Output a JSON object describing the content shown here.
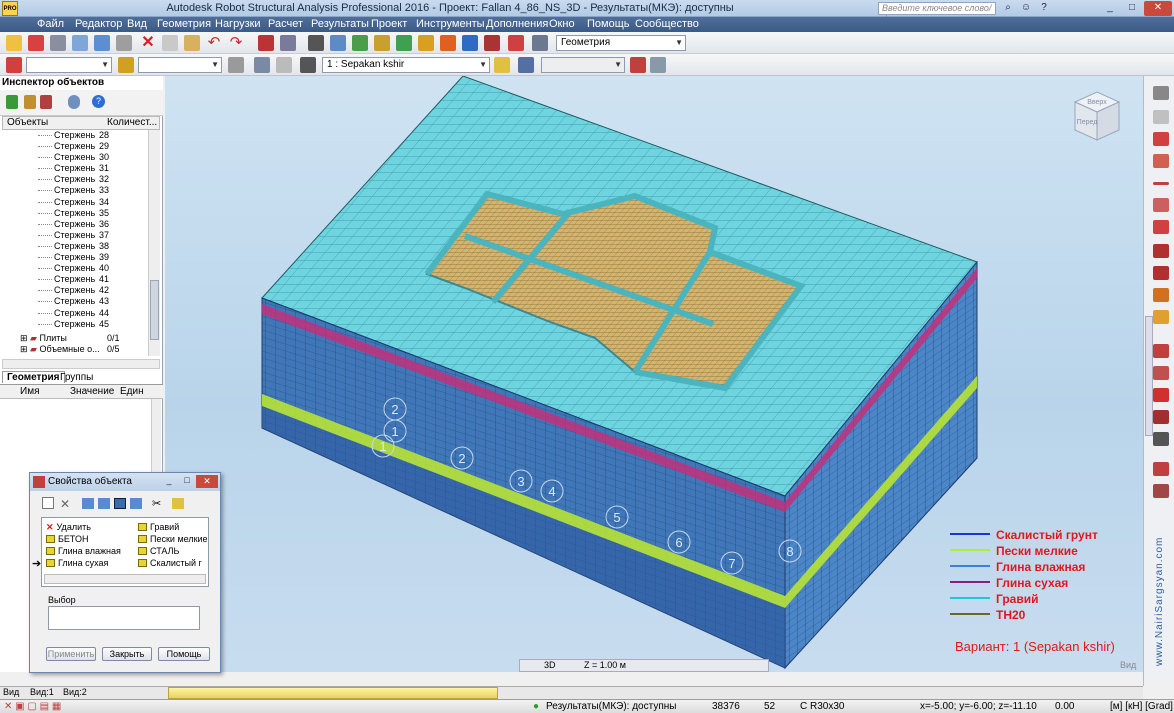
{
  "app": {
    "title": "Autodesk Robot Structural Analysis Professional 2016 - Проект: Fallan 4_86_NS_3D - Результаты(МКЭ): доступны",
    "search_placeholder": "Введите ключевое слово/фразу",
    "logo_label": "PRO"
  },
  "menu": [
    "Файл",
    "Редактор",
    "Вид",
    "Геометрия",
    "Нагрузки",
    "Расчет",
    "Результаты",
    "Проект",
    "Инструменты",
    "Дополнения",
    "Окно",
    "Помощь",
    "Сообщество"
  ],
  "toolbar1": {
    "geometry_combo": "Геометрия"
  },
  "toolbar2": {
    "load_case_combo": "1 : Sepakan kshir"
  },
  "inspector": {
    "title": "Инспектор объектов",
    "col_objects": "Объекты",
    "col_count": "Количест...",
    "bars_label": "Стержень",
    "bars": [
      28,
      29,
      30,
      31,
      32,
      33,
      34,
      35,
      36,
      37,
      38,
      39,
      40,
      41,
      42,
      43,
      44,
      45
    ],
    "plates_label": "Плиты",
    "plates_count": "0/1",
    "volumes_label": "Объемные о...",
    "volumes_count": "0/5",
    "tab_geometry": "Геометрия",
    "tab_groups": "Группы",
    "prop_col_name": "Имя",
    "prop_col_value": "Значение",
    "prop_col_unit": "Един"
  },
  "props_dialog": {
    "title": "Свойства объекта",
    "materials_left": [
      "Удалить",
      "БЕТОН",
      "Глина влажная",
      "Глина сухая"
    ],
    "materials_right": [
      "Гравий",
      "Пески мелкие",
      "СТАЛЬ",
      "Скалистый г"
    ],
    "selection_label": "Выбор",
    "apply_button": "Применить",
    "close_button": "Закрыть",
    "help_button": "Помощь"
  },
  "viewport": {
    "view_mode": "3D",
    "z_level": "Z = 1.00 м",
    "view_cube_top": "Вверх",
    "view_cube_front": "Перед",
    "corner_label": "Вид",
    "variant": "Вариант: 1 (Sepakan kshir)",
    "watermark": "www.NairiSargsyan.com",
    "layer_numbers_left": [
      "2",
      "1",
      "1"
    ],
    "layer_numbers_front": [
      "2",
      "3",
      "4",
      "5",
      "6",
      "7",
      "8"
    ]
  },
  "legend": [
    {
      "label": "Скалистый грунт",
      "color": "#1a33d6"
    },
    {
      "label": "Пески мелкие",
      "color": "#a8f03a"
    },
    {
      "label": "Глина влажная",
      "color": "#3b7fe0"
    },
    {
      "label": "Глина сухая",
      "color": "#8a1e7a"
    },
    {
      "label": "Гравий",
      "color": "#1ec9d4"
    },
    {
      "label": "TH20",
      "color": "#6b6a1c"
    }
  ],
  "bottom_tabs": [
    "Вид",
    "Вид:1",
    "Вид:2"
  ],
  "status": {
    "results": "Результаты(МКЭ): доступны",
    "nodes": "38376",
    "count2": "52",
    "section": "C R30x30",
    "coords": "x=-5.00; y=-6.00; z=-11.10",
    "value": "0.00",
    "units": "[м] [кН] [Grad]"
  },
  "colors": {
    "soil_top": "#6fd3df",
    "soil_side": "#3f74b8",
    "sand_layer": "#b8e236",
    "dry_clay": "#c0307a",
    "foundation": "#d3b06a",
    "beam": "#46b2bd"
  }
}
